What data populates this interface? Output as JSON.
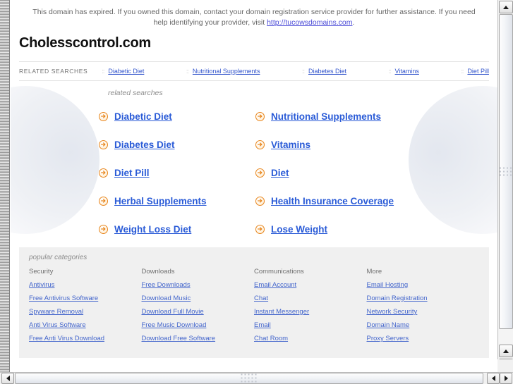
{
  "notice": {
    "text_before": "This domain has expired. If you owned this domain, contact your domain registration service provider for further assistance. If you need help identifying your provider, visit ",
    "link": "http://tucowsdomains.com",
    "text_after": "."
  },
  "domain_title": "Cholesscontrol.com",
  "related_searches_strip": {
    "label": "RELATED SEARCHES",
    "separator": "::",
    "items": [
      "Diabetic Diet",
      "Nutritional Supplements",
      "Diabetes Diet",
      "Vitamins",
      "Diet Pill"
    ]
  },
  "main": {
    "heading": "related searches",
    "column_1": [
      "Diabetic Diet",
      "Diabetes Diet",
      "Diet Pill",
      "Herbal Supplements",
      "Weight Loss Diet"
    ],
    "column_2": [
      "Nutritional Supplements",
      "Vitamins",
      "Diet",
      "Health Insurance Coverage",
      "Lose Weight"
    ]
  },
  "popular_categories": {
    "heading": "popular categories",
    "columns": [
      {
        "title": "Security",
        "links": [
          "Antivirus",
          "Free Antivirus Software",
          "Spyware Removal",
          "Anti Virus Software",
          "Free Anti Virus Download"
        ]
      },
      {
        "title": "Downloads",
        "links": [
          "Free Downloads",
          "Download Music",
          "Download Full Movie",
          "Free Music Download",
          "Download Free Software"
        ]
      },
      {
        "title": "Communications",
        "links": [
          "Email Account",
          "Chat",
          "Instant Messenger",
          "Email",
          "Chat Room"
        ]
      },
      {
        "title": "More",
        "links": [
          "Email Hosting",
          "Domain Registration",
          "Network Security",
          "Domain Name",
          "Proxy Servers"
        ]
      }
    ]
  },
  "colors": {
    "link_blue": "#2a5bd7",
    "bullet_orange": "#e8861e",
    "panel_gray": "#f0f0f0",
    "notice_gray": "#666666"
  }
}
